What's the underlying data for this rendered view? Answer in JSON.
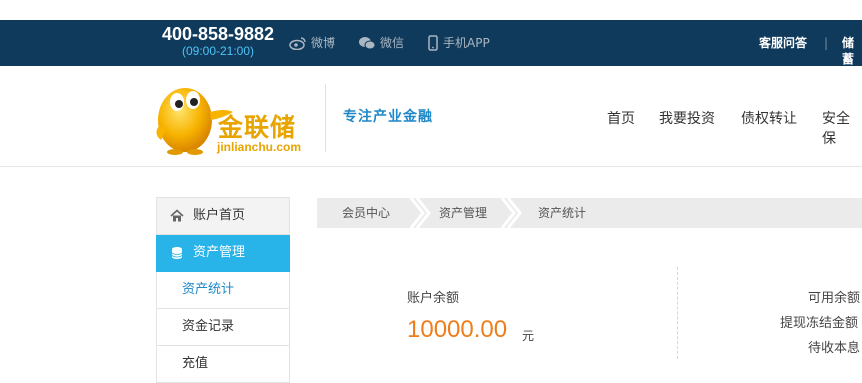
{
  "topbar": {
    "phone": "400-858-9882",
    "hours": "(09:00-21:00)",
    "social": [
      {
        "label": "微博",
        "icon": "weibo-icon"
      },
      {
        "label": "微信",
        "icon": "wechat-icon"
      },
      {
        "label": "手机APP",
        "icon": "mobile-icon"
      }
    ],
    "links": [
      "客服问答",
      "储蓄"
    ],
    "separator": "|"
  },
  "header": {
    "logo_text": "金联储",
    "logo_domain": "jinlianchu.com",
    "slogan": "专注产业金融",
    "nav": [
      "首页",
      "我要投资",
      "债权转让",
      "安全保"
    ]
  },
  "sidebar": {
    "items": [
      {
        "label": "账户首页",
        "icon": "home-icon"
      },
      {
        "label": "资产管理",
        "icon": "database-icon"
      },
      {
        "label": "资产统计"
      },
      {
        "label": "资金记录"
      },
      {
        "label": "充值"
      }
    ]
  },
  "breadcrumb": [
    "会员中心",
    "资产管理",
    "资产统计"
  ],
  "assets": {
    "balance_label": "账户余额",
    "balance_value": "10000.00",
    "balance_unit": "元",
    "right_labels": [
      "可用余额",
      "提现冻结金额",
      "待收本息"
    ]
  },
  "colors": {
    "topbar_bg": "#0f3a5c",
    "accent_blue": "#28b4e8",
    "amount_orange": "#ef7d1a",
    "logo_gold": "#e8a400"
  }
}
